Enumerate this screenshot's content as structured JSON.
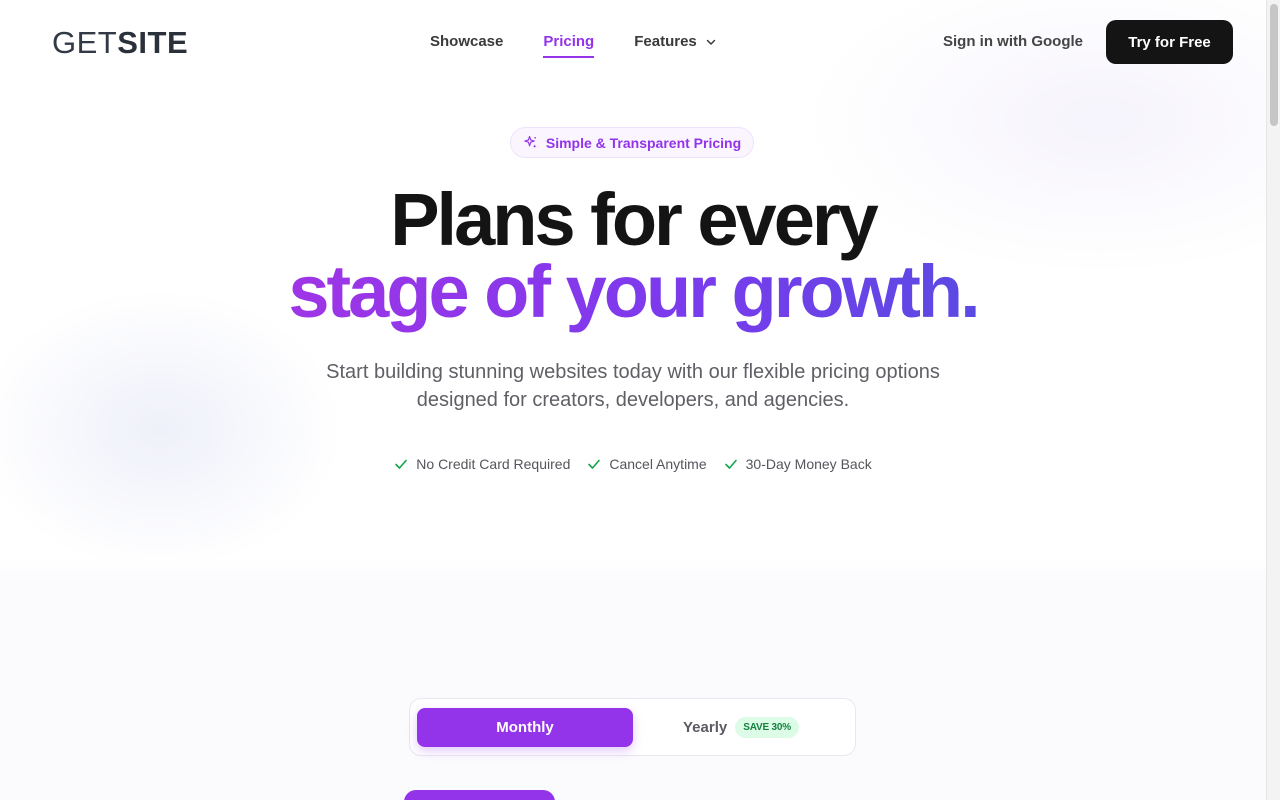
{
  "nav": {
    "logo_get": "GET",
    "logo_site": "SITE",
    "links": [
      {
        "label": "Showcase"
      },
      {
        "label": "Pricing"
      },
      {
        "label": "Features"
      }
    ],
    "signin_label": "Sign in with Google",
    "cta_label": "Try for Free"
  },
  "hero": {
    "badge": "Simple & Transparent Pricing",
    "title_line1": "Plans for every",
    "title_line2": "stage of your growth.",
    "subtitle_line1": "Start building stunning websites today with our flexible pricing options",
    "subtitle_line2": "designed for creators, developers, and agencies.",
    "checks": [
      "No Credit Card Required",
      "Cancel Anytime",
      "30-Day Money Back"
    ]
  },
  "billing_toggle": {
    "monthly_label": "Monthly",
    "yearly_label": "Yearly",
    "save_badge": "SAVE 30%",
    "selected": "Monthly"
  },
  "colors": {
    "accent": "#9333ea",
    "dark": "#141414",
    "check_green": "#16a34a"
  },
  "icons": [
    "sparkle-icon",
    "chevron-down-icon",
    "check-icon"
  ]
}
